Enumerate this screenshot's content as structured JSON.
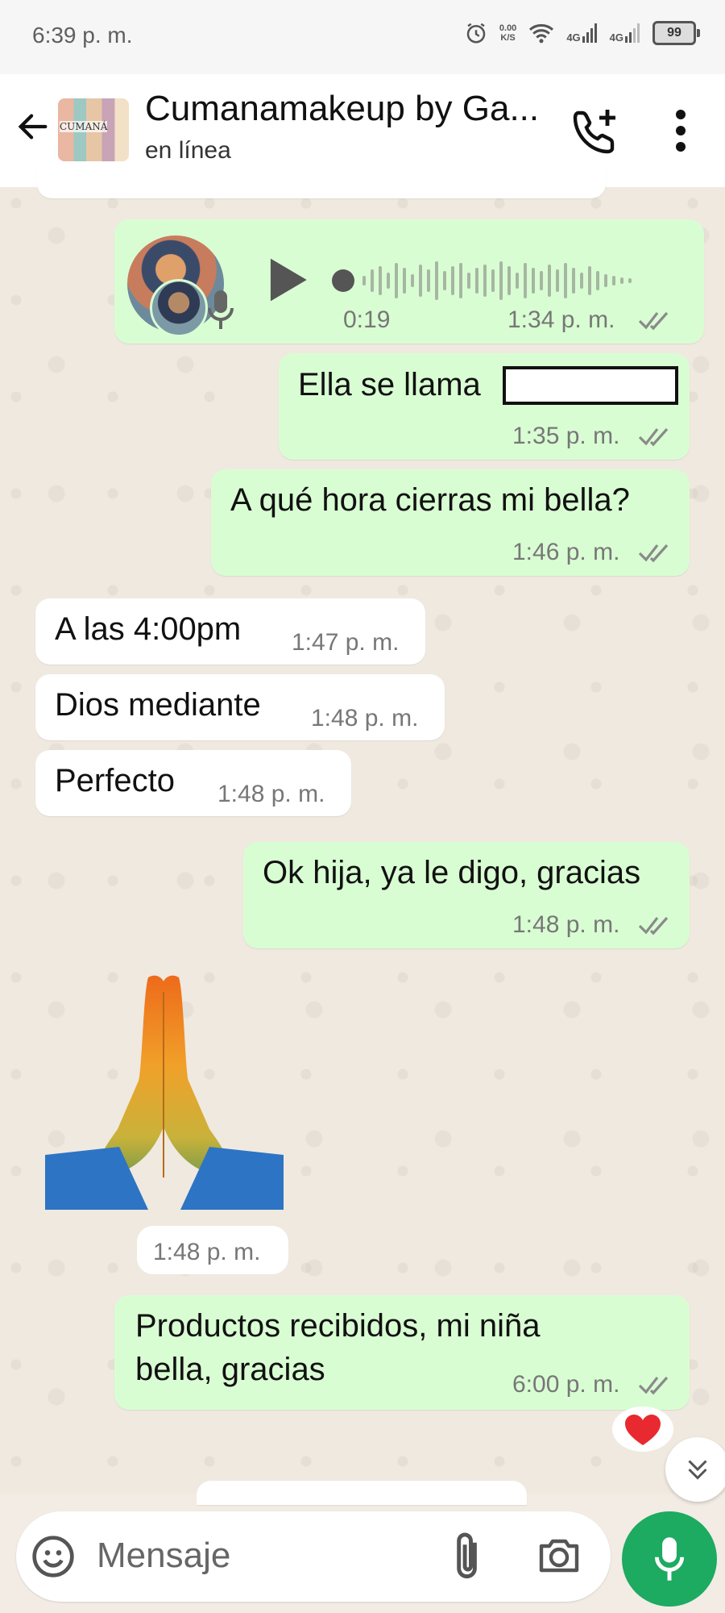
{
  "status_bar": {
    "time": "6:39 p. m.",
    "net_speed": "0.00",
    "net_unit": "K/S",
    "signal_1": "4G",
    "signal_2": "4G",
    "battery": "99"
  },
  "header": {
    "logo_text": "CUMANÁ",
    "title": "Cumanamakeup by Ga...",
    "subtitle": "en línea"
  },
  "messages": [
    {
      "type": "voice",
      "duration": "0:19",
      "time": "1:34 p. m."
    },
    {
      "type": "text",
      "direction": "out",
      "text": "Ella se llama",
      "time": "1:35 p. m."
    },
    {
      "type": "text",
      "direction": "out",
      "text": "A qué hora cierras mi bella?",
      "time": "1:46 p. m."
    },
    {
      "type": "text",
      "direction": "in",
      "text": "A las 4:00pm",
      "time": "1:47 p. m."
    },
    {
      "type": "text",
      "direction": "in",
      "text": "Dios mediante",
      "time": "1:48 p. m."
    },
    {
      "type": "text",
      "direction": "in",
      "text": "Perfecto",
      "time": "1:48 p. m."
    },
    {
      "type": "text",
      "direction": "out",
      "text": "Ok hija, ya le digo, gracias",
      "time": "1:48 p. m."
    },
    {
      "type": "emoji",
      "direction": "in",
      "emoji_name": "folded-hands",
      "time": "1:48 p. m."
    },
    {
      "type": "text",
      "direction": "out",
      "text_line1": "Productos recibidos, mi niña",
      "text_line2": "bella, gracias",
      "time": "6:00 p. m.",
      "reaction": "heart"
    }
  ],
  "input": {
    "placeholder": "Mensaje"
  },
  "colors": {
    "outgoing": "#d9fdd3",
    "incoming": "#ffffff",
    "accent": "#1daa61",
    "tick": "#8a8a8a"
  }
}
